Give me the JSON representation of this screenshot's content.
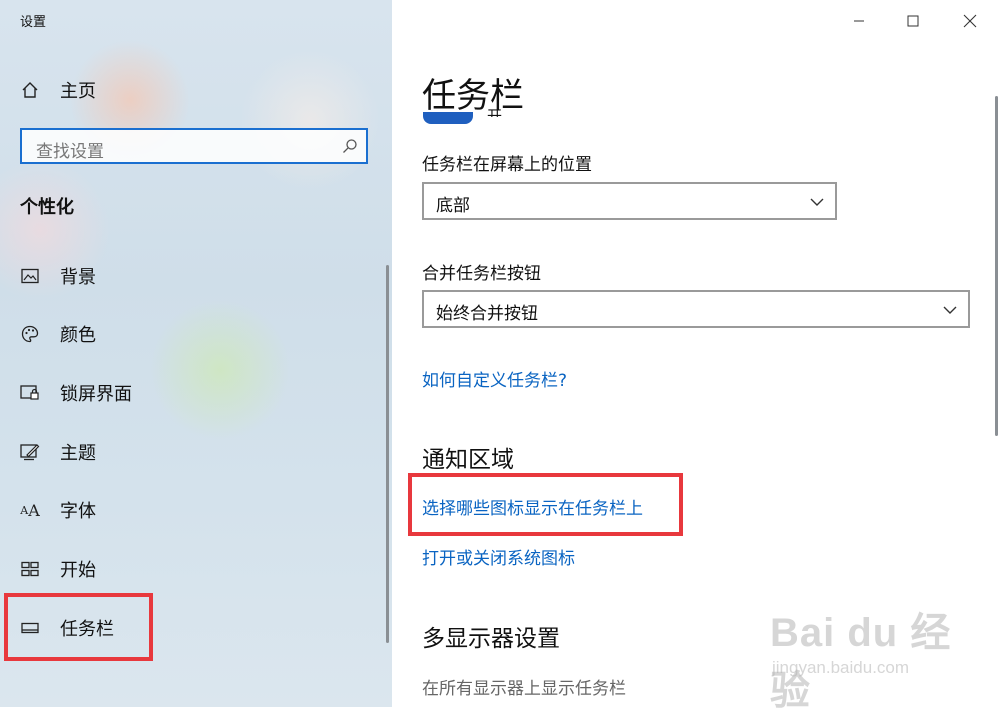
{
  "window": {
    "title": "设置"
  },
  "sidebar": {
    "home_label": "主页",
    "search_placeholder": "查找设置",
    "section_title": "个性化",
    "items": [
      {
        "label": "背景",
        "icon": "image-icon"
      },
      {
        "label": "颜色",
        "icon": "palette-icon"
      },
      {
        "label": "锁屏界面",
        "icon": "lock-screen-icon"
      },
      {
        "label": "主题",
        "icon": "theme-brush-icon"
      },
      {
        "label": "字体",
        "icon": "font-icon",
        "glyph": "A"
      },
      {
        "label": "开始",
        "icon": "start-grid-icon"
      },
      {
        "label": "任务栏",
        "icon": "taskbar-icon",
        "selected": true
      }
    ]
  },
  "main": {
    "page_title": "任务栏",
    "toggle_partial_text": "开",
    "position_label": "任务栏在屏幕上的位置",
    "position_value": "底部",
    "combine_label": "合并任务栏按钮",
    "combine_value": "始终合并按钮",
    "customize_link": "如何自定义任务栏?",
    "notification_heading": "通知区域",
    "select_icons_link": "选择哪些图标显示在任务栏上",
    "system_icons_link": "打开或关闭系统图标",
    "multi_display_heading": "多显示器设置",
    "show_on_all_text": "在所有显示器上显示任务栏"
  },
  "watermark": {
    "brand": "Bai du 经验",
    "url": "jingyan.baidu.com"
  },
  "colors": {
    "accent": "#0a64c2",
    "highlight": "#e8383d",
    "toggle": "#1f5fbf"
  }
}
